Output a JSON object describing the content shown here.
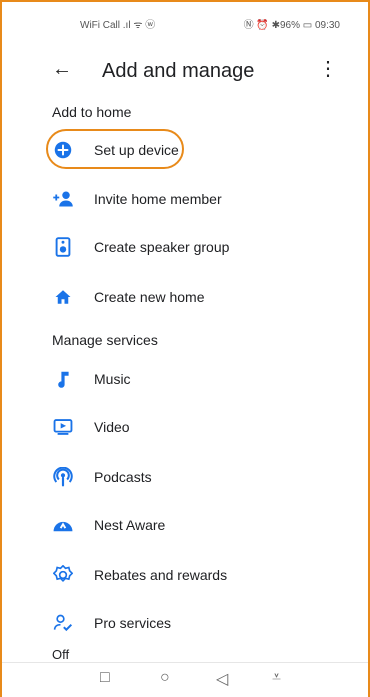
{
  "status": {
    "left": "WiFi Call .ıl ᯤ ⓦ",
    "right": "Ⓝ ⏰ ✱96% ▭ 09:30"
  },
  "appbar": {
    "title": "Add and manage",
    "back_icon": "arrow-left",
    "more_icon": "more-vertical"
  },
  "sections": {
    "add_home": "Add to home",
    "manage": "Manage services",
    "cut": "Off"
  },
  "add_items": [
    {
      "label": "Set up device",
      "icon": "plus-circle-icon"
    },
    {
      "label": "Invite home member",
      "icon": "person-add-icon"
    },
    {
      "label": "Create speaker group",
      "icon": "speaker-icon"
    },
    {
      "label": "Create new home",
      "icon": "home-icon"
    }
  ],
  "manage_items": [
    {
      "label": "Music",
      "icon": "music-note-icon"
    },
    {
      "label": "Video",
      "icon": "video-play-icon"
    },
    {
      "label": "Podcasts",
      "icon": "podcast-icon"
    },
    {
      "label": "Nest Aware",
      "icon": "nest-aware-icon"
    },
    {
      "label": "Rebates and rewards",
      "icon": "rebates-badge-icon"
    },
    {
      "label": "Pro services",
      "icon": "pro-services-icon"
    }
  ],
  "colors": {
    "accent": "#1a73e8",
    "highlight": "#e88a1a"
  },
  "navbar": {
    "square": "□",
    "circle": "○",
    "back": "◁",
    "menu": "⩡"
  }
}
